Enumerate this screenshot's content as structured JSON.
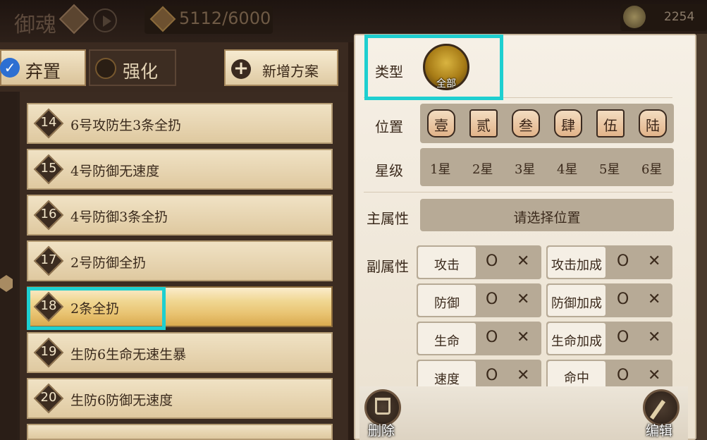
{
  "top": {
    "title": "御魂",
    "bag_count": "5112/6000",
    "coin_count": "2254"
  },
  "tabs": {
    "discard": "弃置",
    "enhance": "强化",
    "add_plan": "新增方案"
  },
  "plans": [
    {
      "num": "14",
      "label": "6号攻防生3条全扔"
    },
    {
      "num": "15",
      "label": "4号防御无速度"
    },
    {
      "num": "16",
      "label": "4号防御3条全扔"
    },
    {
      "num": "17",
      "label": "2号防御全扔"
    },
    {
      "num": "18",
      "label": "2条全扔"
    },
    {
      "num": "19",
      "label": "生防6生命无速生暴"
    },
    {
      "num": "20",
      "label": "生防6防御无速度"
    }
  ],
  "selected_plan": "18",
  "filter": {
    "type_label": "类型",
    "type_value": "全部",
    "position_label": "位置",
    "positions": [
      "壹",
      "贰",
      "叁",
      "肆",
      "伍",
      "陆"
    ],
    "star_label": "星级",
    "stars": [
      "1星",
      "2星",
      "3星",
      "4星",
      "5星",
      "6星"
    ],
    "main_attr_label": "主属性",
    "main_attr_placeholder": "请选择位置",
    "sub_attr_label": "副属性",
    "sub_attrs": [
      {
        "name": "攻击",
        "yes": "O",
        "no": "✕"
      },
      {
        "name": "攻击加成",
        "yes": "O",
        "no": "✕"
      },
      {
        "name": "防御",
        "yes": "O",
        "no": "✕"
      },
      {
        "name": "防御加成",
        "yes": "O",
        "no": "✕"
      },
      {
        "name": "生命",
        "yes": "O",
        "no": "✕"
      },
      {
        "name": "生命加成",
        "yes": "O",
        "no": "✕"
      },
      {
        "name": "速度",
        "yes": "O",
        "no": "✕"
      },
      {
        "name": "命中",
        "yes": "O",
        "no": "✕"
      }
    ]
  },
  "actions": {
    "delete": "删除",
    "edit": "编辑"
  },
  "colors": {
    "highlight": "#1ecfd0",
    "check": "#2d6fd2",
    "gold": "#d9aa4f"
  }
}
